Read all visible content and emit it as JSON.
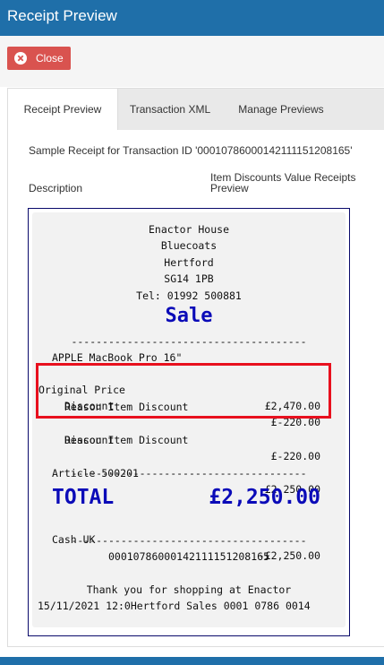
{
  "window": {
    "title": "Receipt Preview"
  },
  "toolbar": {
    "close_label": "Close"
  },
  "tabs": [
    {
      "label": "Receipt Preview",
      "active": true
    },
    {
      "label": "Transaction XML",
      "active": false
    },
    {
      "label": "Manage Previews",
      "active": false
    }
  ],
  "sample_text": "Sample Receipt for Transaction ID '00010786000142111151208165'",
  "columns": {
    "description": "Description",
    "preview": "Item Discounts Value Receipts Preview"
  },
  "receipt": {
    "header": [
      "Enactor House",
      "Bluecoats",
      "Hertford",
      "SG14 1PB",
      "Tel: 01992 500881"
    ],
    "sale_title": "Sale",
    "divider": "--------------------------------------",
    "item_name": "APPLE MacBook Pro 16\"",
    "original_price_label": "Original Price",
    "original_price_value": "£2,470.00",
    "discount1_label": "Discount",
    "discount1_value": "£-220.00",
    "reason1": "Reason Item Discount",
    "discount2_label": "Discount",
    "discount2_value": "£-220.00",
    "reason2": "Reason Item Discount",
    "article_label": "Article 500201",
    "article_value": "£2,250.00",
    "total_label": "TOTAL",
    "total_value": "£2,250.00",
    "tender_label": "Cash UK",
    "tender_value": "-£2,250.00",
    "transaction_id": "00010786000142111151208165",
    "thanks": "Thank you for shopping at Enactor",
    "footer": "15/11/2021 12:0Hertford Sales 0001 0786 0014"
  },
  "colors": {
    "titlebar": "#1f6fa9",
    "close_button": "#d9534f",
    "receipt_accent": "#0b0bb8",
    "highlight": "#e8101e"
  }
}
